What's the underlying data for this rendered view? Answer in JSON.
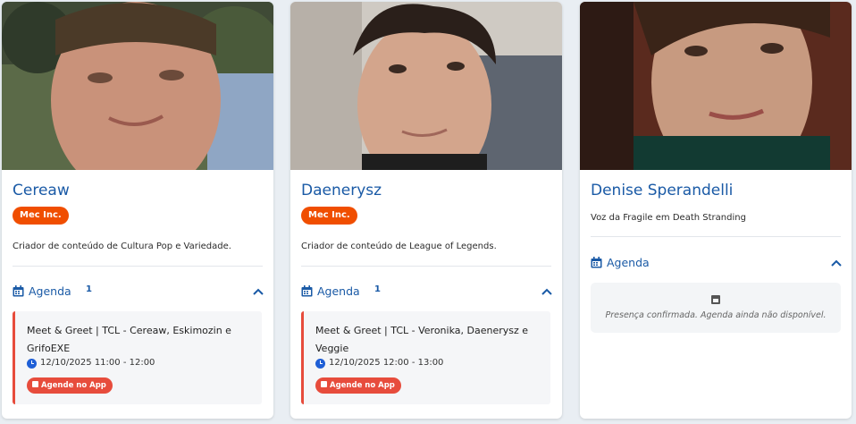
{
  "colors": {
    "link_blue": "#1a5aa6",
    "badge_orange": "#f04e00",
    "accent_red": "#e74c3c",
    "clock_blue": "#1f5fd6"
  },
  "cards": [
    {
      "name": "Cereaw",
      "badge": "Mec Inc.",
      "description": "Criador de conteúdo de Cultura Pop e Variedade.",
      "agenda": {
        "label": "Agenda",
        "count": "1",
        "icon": "calendar-icon",
        "toggle_icon": "chevron-up-icon",
        "event": {
          "title": "Meet & Greet | TCL - Cereaw, Eskimozin e GrifoEXE",
          "time": "12/10/2025 11:00 - 12:00",
          "button": "Agende no App"
        }
      }
    },
    {
      "name": "Daenerysz",
      "badge": "Mec Inc.",
      "description": "Criador de conteúdo de League of Legends.",
      "agenda": {
        "label": "Agenda",
        "count": "1",
        "icon": "calendar-icon",
        "toggle_icon": "chevron-up-icon",
        "event": {
          "title": "Meet & Greet | TCL - Veronika, Daenerysz e Veggie",
          "time": "12/10/2025 12:00 - 13:00",
          "button": "Agende no App"
        }
      }
    },
    {
      "name": "Denise Sperandelli",
      "description": "Voz da Fragile em Death Stranding",
      "agenda": {
        "label": "Agenda",
        "icon": "calendar-icon",
        "toggle_icon": "chevron-up-icon",
        "empty_message": "Presença confirmada. Agenda ainda não disponível."
      }
    }
  ]
}
